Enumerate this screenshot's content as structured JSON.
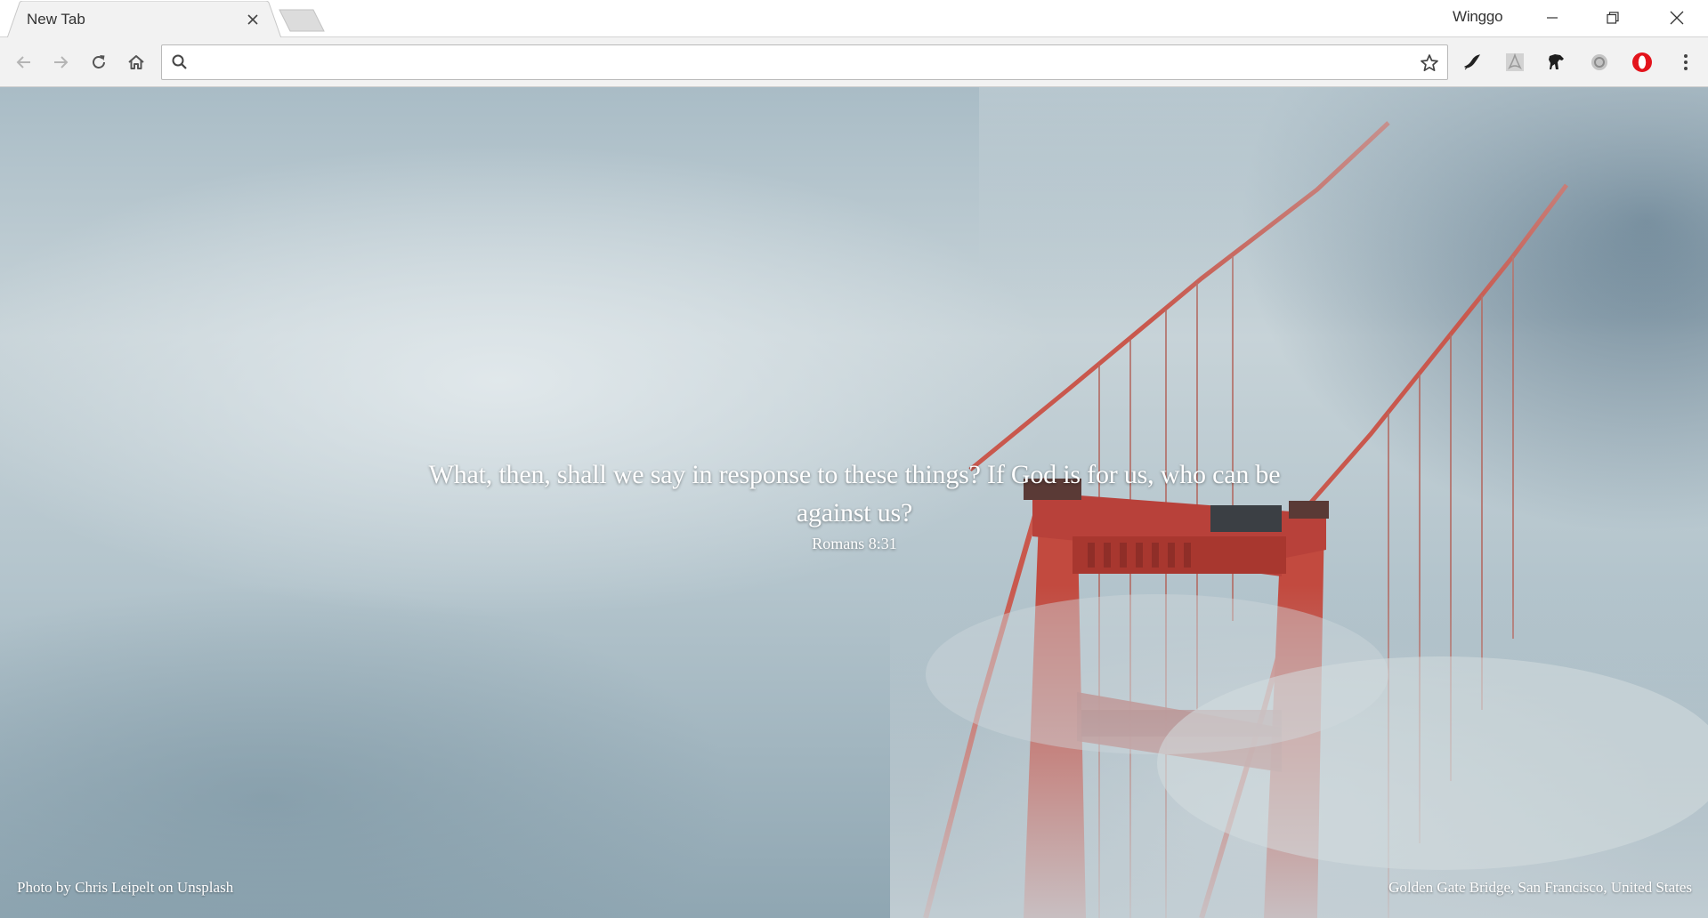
{
  "window": {
    "profile_name": "Winggo"
  },
  "tabs": [
    {
      "title": "New Tab"
    }
  ],
  "toolbar": {
    "omnibox_value": "",
    "extensions": [
      "feather-extension-icon",
      "pdf-extension-icon",
      "horse-extension-icon",
      "grey-circle-extension-icon",
      "opera-extension-icon"
    ]
  },
  "newtab": {
    "quote": "What, then, shall we say in response to these things? If God is for us, who can be against us?",
    "reference": "Romans 8:31",
    "photo_credit": "Photo by Chris Leipelt on Unsplash",
    "location": "Golden Gate Bridge, San Francisco, United States"
  },
  "colors": {
    "bridge_red": "#c9453a",
    "sky": "#b7c7cf"
  }
}
